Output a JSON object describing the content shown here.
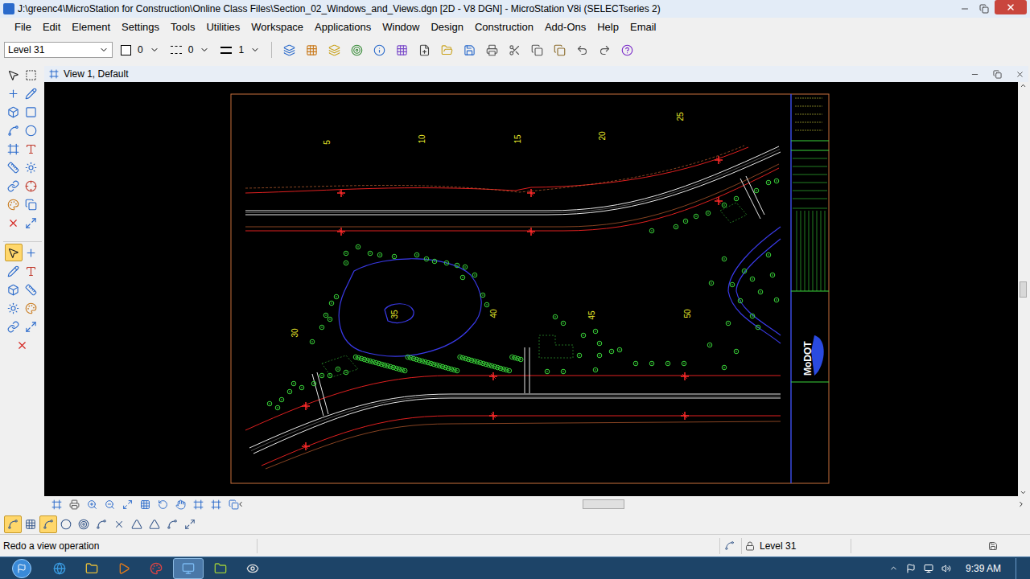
{
  "window": {
    "title": "J:\\greenc4\\MicroStation for Construction\\Online Class Files\\Section_02_Windows_and_Views.dgn [2D - V8 DGN] - MicroStation V8i (SELECTseries 2)"
  },
  "menu": [
    "File",
    "Edit",
    "Element",
    "Settings",
    "Tools",
    "Utilities",
    "Workspace",
    "Applications",
    "Window",
    "Design",
    "Construction",
    "Add-Ons",
    "Help",
    "Email"
  ],
  "attributes": {
    "level": "Level 31",
    "color": "0",
    "style": "0",
    "weight": "1"
  },
  "left_tools": [
    {
      "kind": "main",
      "selected": false
    },
    {
      "kind": "task",
      "selected": true
    }
  ],
  "view": {
    "title": "View 1, Default",
    "stations": [
      "5",
      "10",
      "15",
      "20",
      "25",
      "30",
      "35",
      "40",
      "45",
      "50"
    ],
    "logo": "MoDOT"
  },
  "snap_tools": [
    {
      "kind": "snap",
      "selected": true
    },
    {
      "kind": "line",
      "selected": false
    },
    {
      "kind": "grid",
      "selected": true
    }
  ],
  "status_bar": {
    "prompt": "Redo a view operation",
    "level": "Level 31"
  },
  "taskbar": {
    "time": "9:39 AM",
    "apps": [
      {
        "kind": "ie",
        "selected": false
      },
      {
        "kind": "explorer",
        "selected": false
      },
      {
        "kind": "media",
        "selected": false
      },
      {
        "kind": "paint",
        "selected": false
      },
      {
        "kind": "microstation",
        "selected": true
      },
      {
        "kind": "folder",
        "selected": false
      },
      {
        "kind": "tool",
        "selected": false
      }
    ]
  }
}
